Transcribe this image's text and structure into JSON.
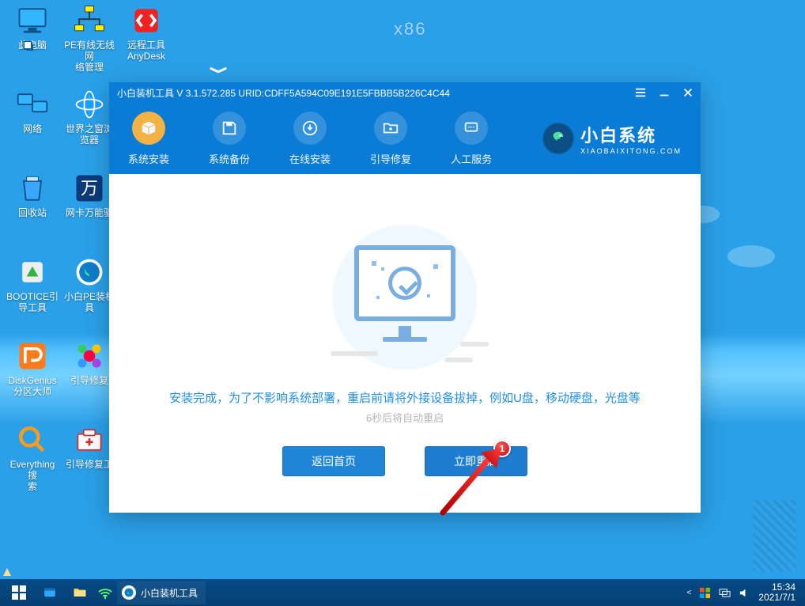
{
  "x86_label": "x86",
  "desktop_icons": {
    "col": [
      [
        "此电脑",
        "PE有线无线网\n络管理",
        "远程工具\nAnyDesk"
      ],
      [
        "网络",
        "世界之窗浏\n览器",
        ""
      ],
      [
        "回收站",
        "网卡万能驱",
        ""
      ],
      [
        "BOOTICE引\n导工具",
        "小白PE装机\n具",
        ""
      ],
      [
        "DiskGenius\n分区大师",
        "引导修复",
        ""
      ],
      [
        "Everything搜\n索",
        "引导修复工",
        ""
      ]
    ]
  },
  "app": {
    "title": "小白装机工具 V 3.1.572.285 URID:CDFF5A594C09E191E5FBBB5B226C4C44",
    "brand_big": "小白系统",
    "brand_small": "XIAOBAIXITONG.COM",
    "tabs": [
      {
        "label": "系统安装",
        "active": true
      },
      {
        "label": "系统备份",
        "active": false
      },
      {
        "label": "在线安装",
        "active": false
      },
      {
        "label": "引导修复",
        "active": false
      },
      {
        "label": "人工服务",
        "active": false
      }
    ],
    "message": "安装完成，为了不影响系统部署，重启前请将外接设备拔掉，例如U盘，移动硬盘，光盘等",
    "countdown": "6秒后将自动重启",
    "btn_back": "返回首页",
    "btn_restart": "立即重启"
  },
  "marker": "1",
  "taskbar": {
    "app_label": "小白装机工具"
  },
  "clock": {
    "time": "15:34",
    "date": "2021/7/1"
  }
}
